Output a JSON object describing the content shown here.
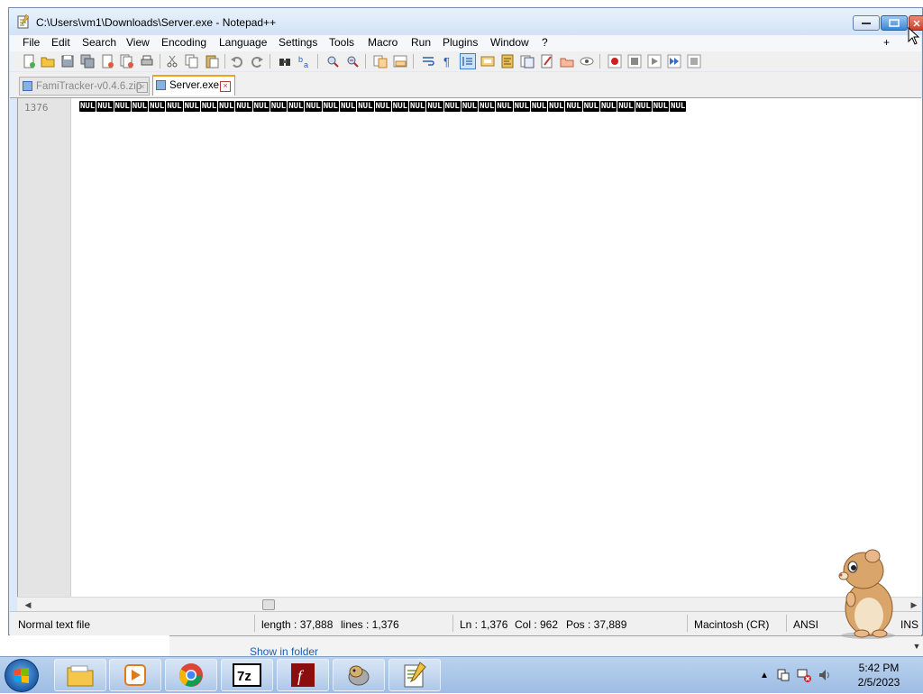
{
  "window": {
    "title": "C:\\Users\\vm1\\Downloads\\Server.exe - Notepad++"
  },
  "menu": {
    "items": [
      "File",
      "Edit",
      "Search",
      "View",
      "Encoding",
      "Language",
      "Settings",
      "Tools",
      "Macro",
      "Run",
      "Plugins",
      "Window",
      "?"
    ],
    "plus": "+",
    "close": "x"
  },
  "toolbar": {
    "icons": [
      "new-file-icon",
      "open-file-icon",
      "save-icon",
      "save-all-icon",
      "close-icon",
      "close-all-icon",
      "print-icon",
      "cut-icon",
      "copy-icon",
      "paste-icon",
      "undo-icon",
      "redo-icon",
      "find-icon",
      "replace-icon",
      "zoom-in-icon",
      "zoom-out-icon",
      "sync-vertical-icon",
      "sync-horizontal-icon",
      "word-wrap-icon",
      "show-all-chars-icon",
      "indent-guide-icon",
      "udl-icon",
      "doc-map-icon",
      "function-list-icon",
      "folder-workspace-icon",
      "monitoring-icon",
      "record-macro-icon",
      "stop-record-icon",
      "play-macro-icon",
      "run-macro-multiple-icon",
      "save-macro-icon"
    ]
  },
  "tabs": [
    {
      "label": "FamiTracker-v0.4.6.zip",
      "active": false
    },
    {
      "label": "Server.exe",
      "active": true
    }
  ],
  "editor": {
    "line_number": "1376",
    "nul_token": "NUL",
    "nul_count": 35
  },
  "status": {
    "file_type": "Normal text file",
    "length": "length : 37,888",
    "lines": "lines : 1,376",
    "ln": "Ln : 1,376",
    "col": "Col : 962",
    "pos": "Pos : 37,889",
    "eol": "Macintosh (CR)",
    "encoding": "ANSI",
    "mode": "INS"
  },
  "background_window": {
    "link": "Show in folder"
  },
  "taskbar": {
    "apps": [
      "file-explorer-icon",
      "media-player-icon",
      "chrome-icon",
      "7zip-icon",
      "flash-icon",
      "game-icon",
      "notepadpp-icon"
    ],
    "time": "5:42 PM",
    "date": "2/5/2023"
  },
  "colors": {
    "accent_tab": "#f4a21a",
    "nul_bg": "#000000",
    "title_bar": "#d2e3f6"
  }
}
